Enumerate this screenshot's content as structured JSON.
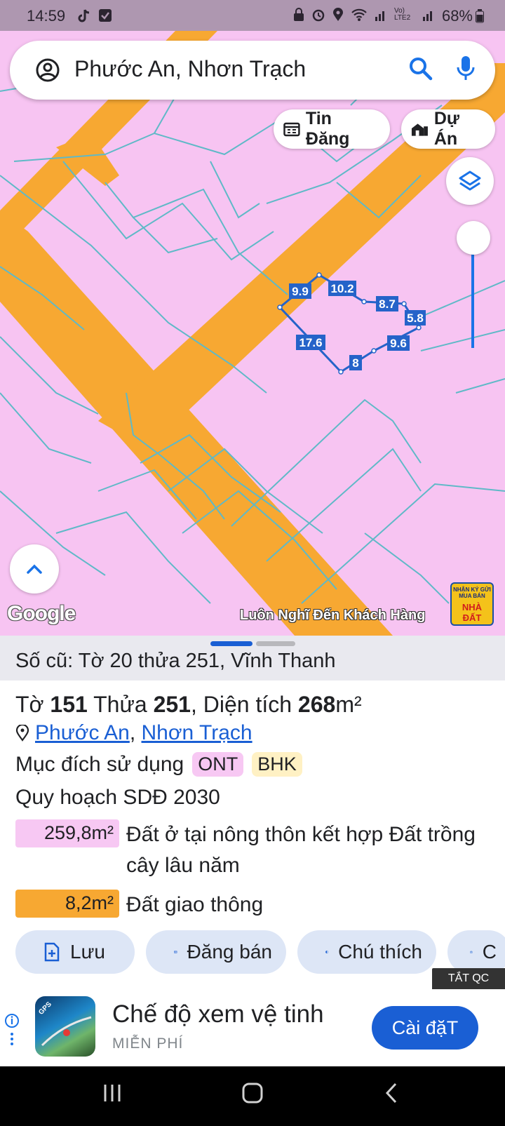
{
  "status_bar": {
    "time": "14:59",
    "signal_label": "Vo) LTE2",
    "battery": "68%"
  },
  "search": {
    "query": "Phước An, Nhơn Trạch"
  },
  "chips": {
    "listings": "Tin Đăng",
    "projects": "Dự Án"
  },
  "map": {
    "parcel_edges": [
      "9.9",
      "10.2",
      "8.7",
      "5.8",
      "9.6",
      "8",
      "17.6"
    ],
    "attribution": "Google",
    "watermark": "Luôn Nghĩ Đến Khách Hàng",
    "ad_logo_small": "NHẬN KÝ GỬI MUA BÁN",
    "ad_logo_big": "NHÀ ĐẤT",
    "colors": {
      "residential": "#f7c4f2",
      "road": "#f7a832",
      "boundary": "#5fb9c7",
      "selection": "#2563c9"
    }
  },
  "sheet": {
    "old_id": "Số cũ: Tờ 20 thửa 251, Vĩnh Thanh",
    "parcel": {
      "sheet_label": "Tờ",
      "sheet_no": "151",
      "lot_label": "Thửa",
      "lot_no": "251",
      "area_label": ", Diện tích",
      "area_value": "268",
      "area_unit": "m²"
    },
    "location": {
      "ward": "Phước An",
      "separator": ",",
      "district": "Nhơn Trạch"
    },
    "purpose_label": "Mục đích sử dụng",
    "purpose_tags": [
      "ONT",
      "BHK"
    ],
    "plan_label": "Quy hoạch SDĐ 2030",
    "plan_areas": [
      {
        "area": "259,8m²",
        "desc": "Đất ở tại nông thôn kết hợp Đất trồng cây lâu năm"
      },
      {
        "area": "8,2m²",
        "desc": "Đất giao thông"
      }
    ],
    "actions": {
      "save": "Lưu",
      "sell": "Đăng bán",
      "legend": "Chú thích",
      "photo": "C"
    },
    "close_ad": "TẮT QC"
  },
  "ad": {
    "title": "Chế độ xem vệ tinh",
    "subtitle": "MIỄN PHÍ",
    "install": "Cài đặT",
    "icon_badge": "GPS"
  }
}
